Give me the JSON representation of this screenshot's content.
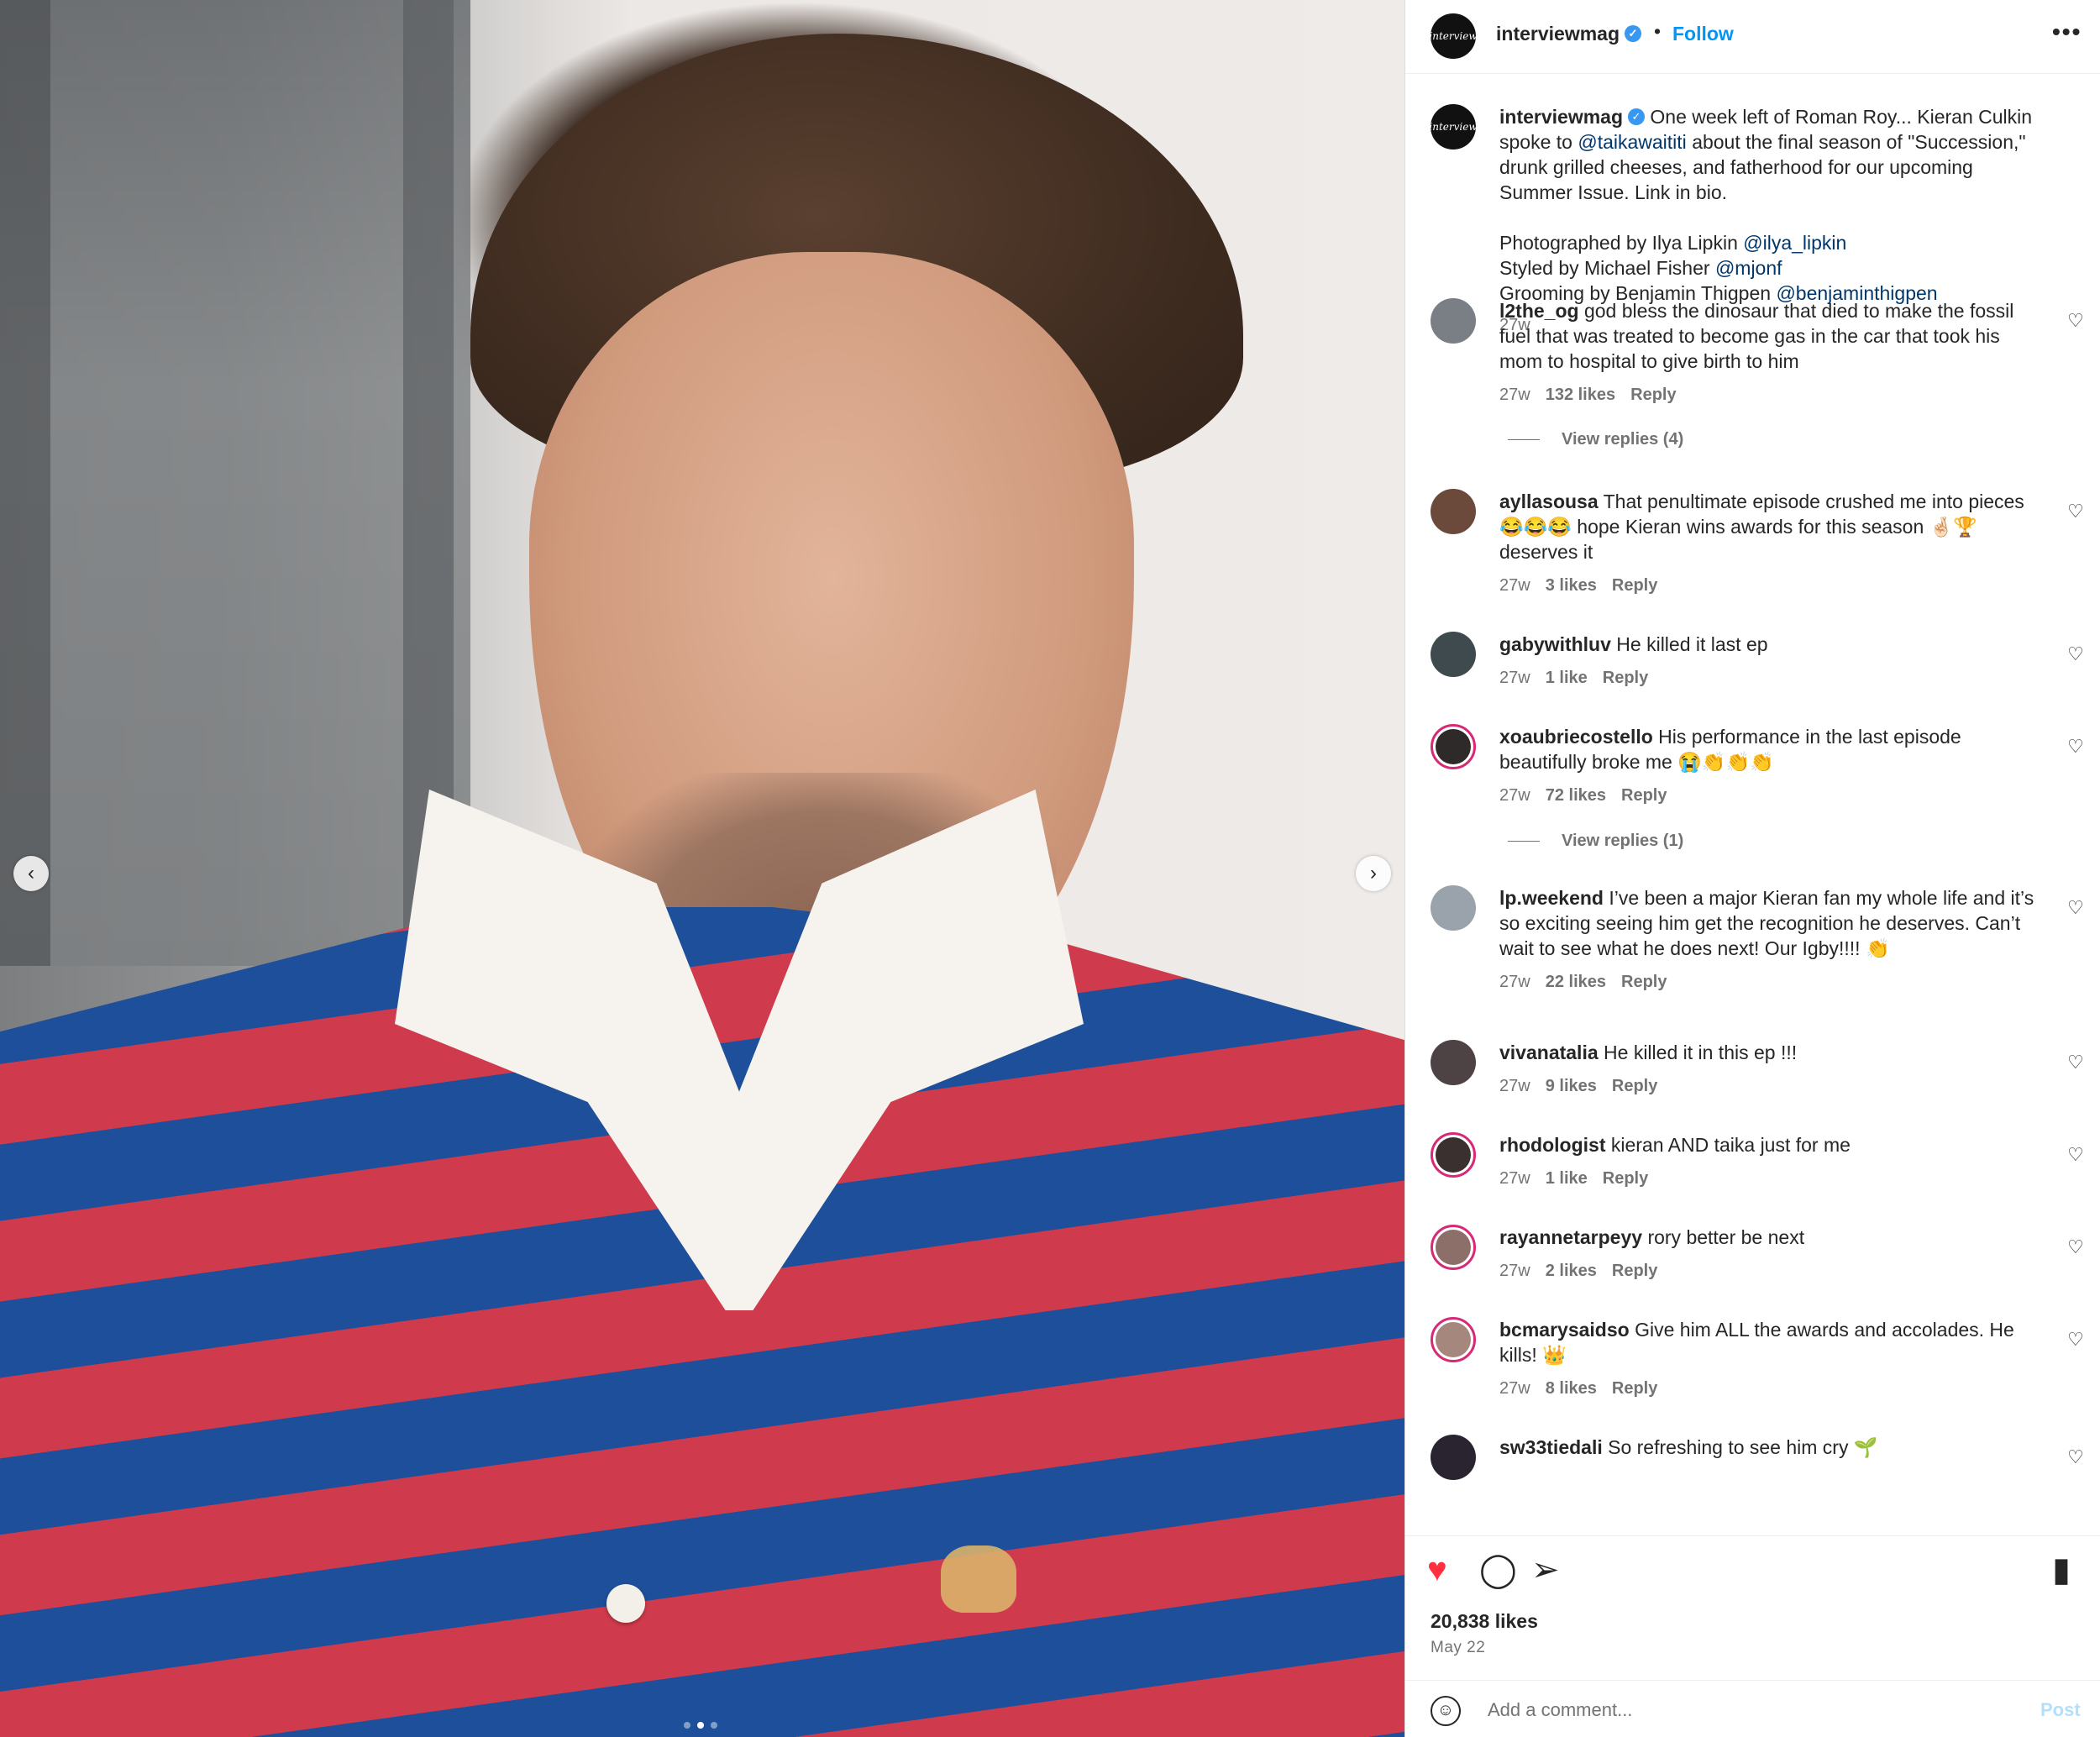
{
  "post": {
    "username": "interviewmag",
    "avatar_text": "interview",
    "follow_label": "Follow",
    "separator": "•",
    "more_label": "•••",
    "carousel": {
      "slide_count": 3,
      "active_slide": 2,
      "prev_icon": "‹",
      "next_icon": "›"
    }
  },
  "caption": {
    "username": "interviewmag",
    "text_1": "One week left of Roman Roy... Kieran Culkin spoke to",
    "mention_1": "@taikawaititi",
    "text_2": "about the final season of \"Succession,\" drunk grilled cheeses, and fatherhood for our upcoming Summer Issue. Link in bio.",
    "credit_1": "Photographed by Ilya Lipkin",
    "credit_1_mention": "@ilya_lipkin",
    "credit_2": "Styled by Michael Fisher",
    "credit_2_mention": "@mjonf",
    "credit_3": "Grooming by Benjamin Thigpen",
    "credit_3_mention": "@benjaminthigpen",
    "time": "27w"
  },
  "comments": [
    {
      "user": "l2the_og",
      "text": "god bless the dinosaur that died to make the fossil fuel that was treated to become gas in the car that took his mom to hospital to give birth to him",
      "time": "27w",
      "likes": "132 likes",
      "reply": "Reply",
      "view_replies": "View replies (4)",
      "avatar_color": "#7a7f86"
    },
    {
      "user": "ayllasousa",
      "text": "That penultimate episode crushed me into pieces 😂😂😂 hope Kieran wins awards for this season 🤞🏻🏆 deserves it",
      "time": "27w",
      "likes": "3 likes",
      "reply": "Reply",
      "avatar_color": "#6b4a3c"
    },
    {
      "user": "gabywithluv",
      "text": "He killed it last ep",
      "time": "27w",
      "likes": "1 like",
      "reply": "Reply",
      "avatar_color": "#3f4a4f"
    },
    {
      "user": "xoaubriecostello",
      "text": "His performance in the last episode beautifully broke me 😭👏👏👏",
      "time": "27w",
      "likes": "72 likes",
      "reply": "Reply",
      "view_replies": "View replies (1)",
      "avatar_color": "#2e2a2a"
    },
    {
      "user": "lp.weekend",
      "text": "I’ve been a major Kieran fan my whole life and it’s so exciting seeing him get the recognition he deserves. Can’t wait to see what he does next! Our Igby!!!! 👏",
      "time": "27w",
      "likes": "22 likes",
      "reply": "Reply",
      "avatar_color": "#9aa2ab"
    },
    {
      "user": "vivanatalia",
      "text": "He killed it in this ep !!!",
      "time": "27w",
      "likes": "9 likes",
      "reply": "Reply",
      "avatar_color": "#4d4345"
    },
    {
      "user": "rhodologist",
      "text": "kieran AND taika just for me",
      "time": "27w",
      "likes": "1 like",
      "reply": "Reply",
      "avatar_color": "#3a3030"
    },
    {
      "user": "rayannetarpeyy",
      "text": "rory better be next",
      "time": "27w",
      "likes": "2 likes",
      "reply": "Reply",
      "avatar_color": "#8d6f6a"
    },
    {
      "user": "bcmarysaidso",
      "text": "Give him ALL the awards and accolades. He kills! 👑",
      "time": "27w",
      "likes": "8 likes",
      "reply": "Reply",
      "avatar_color": "#a6877d"
    },
    {
      "user": "sw33tiedali",
      "text": "So refreshing to see him cry 🌱",
      "time": "",
      "likes": "",
      "reply": "",
      "avatar_color": "#2a2430"
    }
  ],
  "comment_like_icon": "♡",
  "actions": {
    "like_icon": "♥",
    "comment_icon": "◯",
    "share_icon": "➢",
    "save_icon": "▮",
    "likes": "20,838 likes",
    "date": "May 22"
  },
  "add_comment": {
    "emoji_icon": "☺",
    "placeholder": "Add a comment...",
    "post_label": "Post"
  },
  "colors": {
    "link": "#0095f6",
    "mention": "#00376b",
    "muted": "#737373",
    "like": "#ff3040"
  }
}
